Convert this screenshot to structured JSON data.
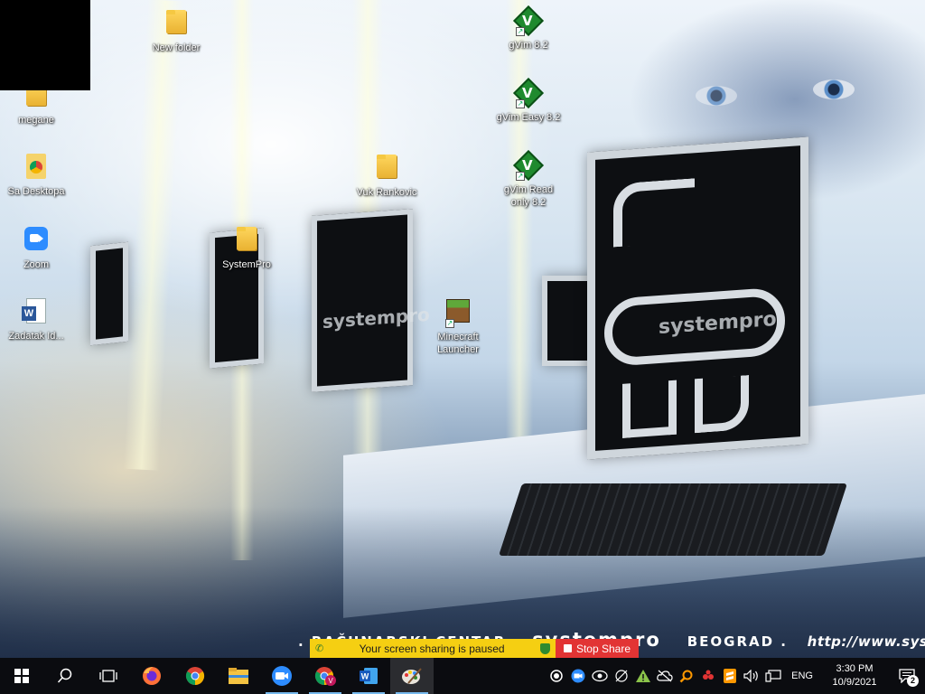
{
  "desktop": {
    "icons": [
      {
        "label": "New folder"
      },
      {
        "label": "megane"
      },
      {
        "label": "Sa Desktopa"
      },
      {
        "label": "Zoom"
      },
      {
        "label": "Zadatak Id..."
      },
      {
        "label": "SystemPro"
      },
      {
        "label": "Vuk Rankovic"
      },
      {
        "label": "Minecraft Launcher"
      },
      {
        "label": "gVim 8.2"
      },
      {
        "label": "gVim Easy 8.2"
      },
      {
        "label": "gVim Read only 8.2"
      }
    ]
  },
  "wallpaper": {
    "monitor_brand_a": "systempro",
    "monitor_brand_b": "systempro",
    "footer_left": ". RAČUNARSKI CENTAR",
    "footer_brand": "systempro",
    "footer_city": "BEOGRAD .",
    "footer_url": "http://www.systempro.rs ."
  },
  "share_bar": {
    "paused_text": "Your screen sharing is paused",
    "stop_label": "Stop Share",
    "paused_color": "#f5cf12",
    "stop_color": "#e23434"
  },
  "taskbar": {
    "apps": [
      "firefox-icon",
      "chrome-icon",
      "file-explorer-icon",
      "zoom-icon",
      "chrome-profile-icon",
      "word-icon",
      "paint-icon"
    ],
    "language": "ENG",
    "time": "3:30 PM",
    "date": "10/9/2021",
    "notification_count": "2"
  }
}
